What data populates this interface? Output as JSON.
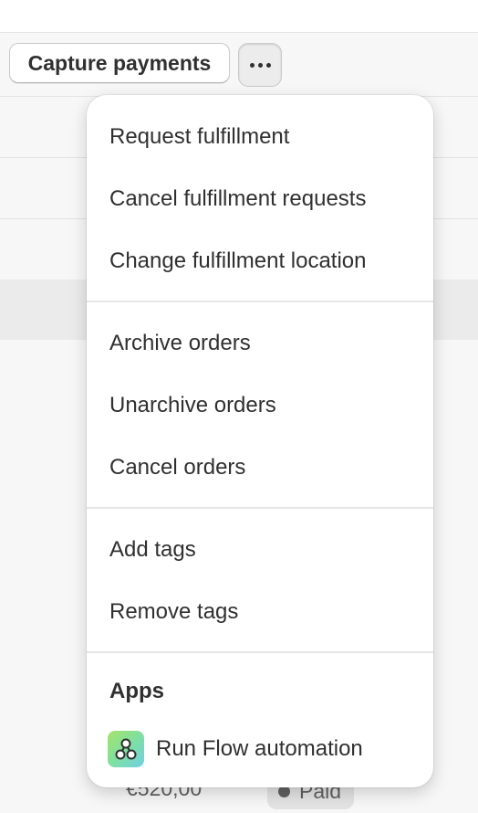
{
  "toolbar": {
    "capture_label": "Capture payments",
    "more_icon": "ellipsis-icon"
  },
  "background_rows": {
    "last_row": {
      "amount": "€520,00",
      "payment_status": "Paid"
    }
  },
  "menu": {
    "groups": [
      [
        "Request fulfillment",
        "Cancel fulfillment requests",
        "Change fulfillment location"
      ],
      [
        "Archive orders",
        "Unarchive orders",
        "Cancel orders"
      ],
      [
        "Add tags",
        "Remove tags"
      ]
    ],
    "apps": {
      "heading": "Apps",
      "items": [
        {
          "label": "Run Flow automation",
          "icon": "flow-icon"
        }
      ]
    }
  },
  "colors": {
    "flow_icon_gradient": [
      "#a6e36a",
      "#6fd0e6"
    ],
    "badge_background": "#e3e3e3"
  }
}
